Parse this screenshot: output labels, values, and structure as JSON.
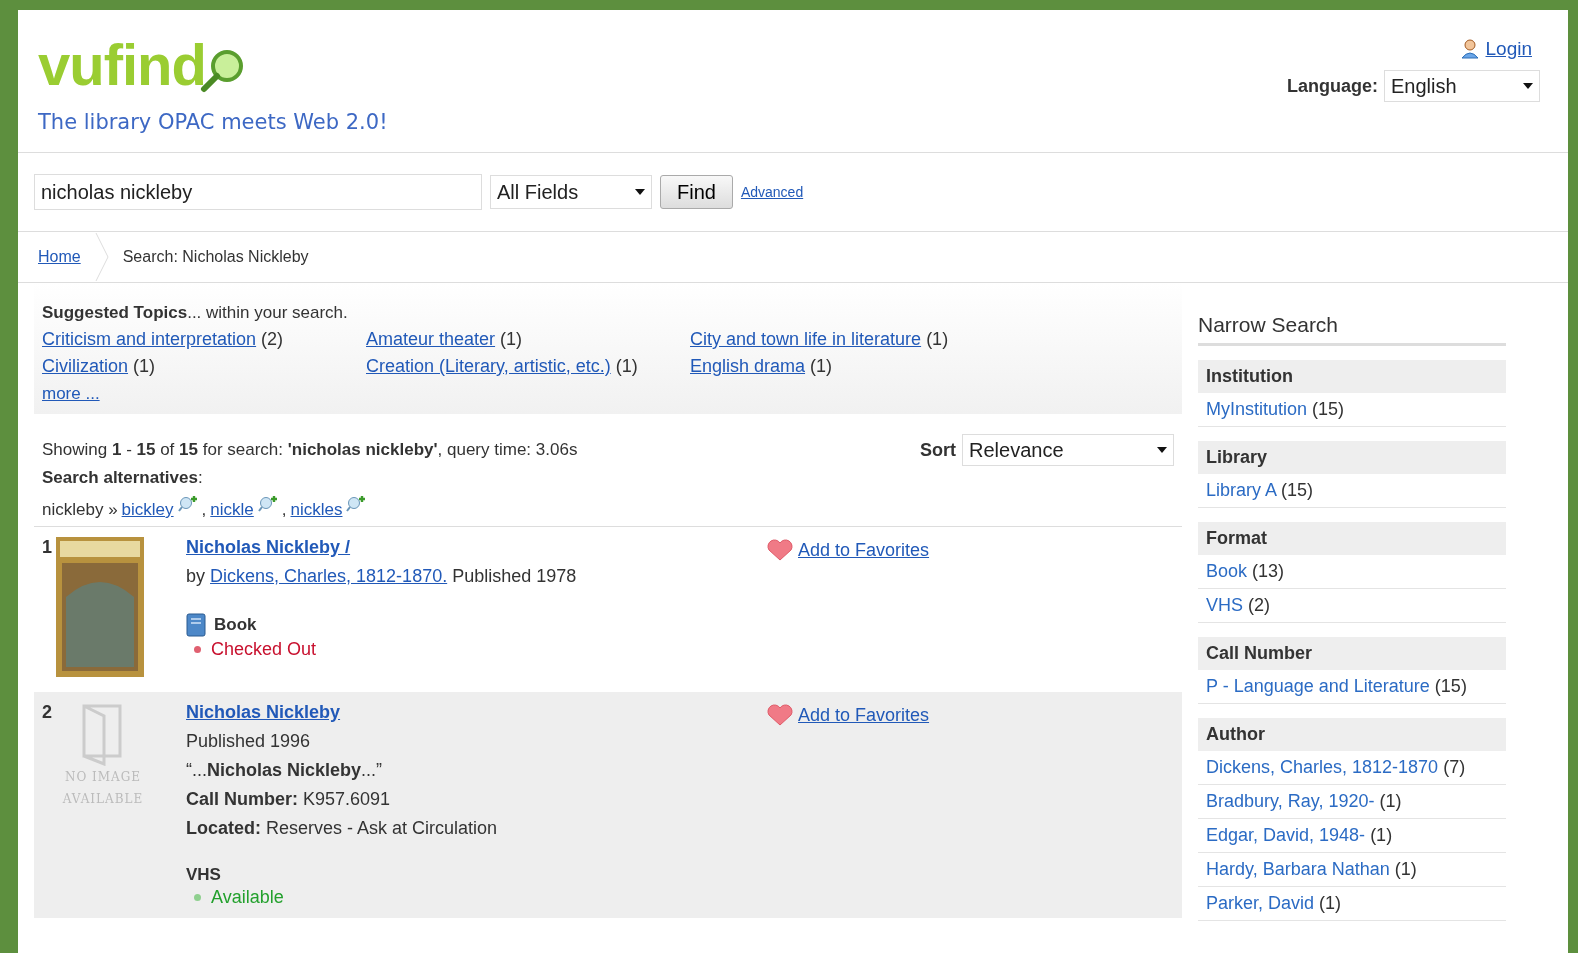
{
  "header": {
    "logo": "vufind",
    "tagline": "The library OPAC meets Web 2.0!",
    "login": "Login",
    "language_label": "Language:",
    "language": "English"
  },
  "search": {
    "value": "nicholas nickleby",
    "field": "All Fields",
    "button": "Find",
    "advanced": "Advanced"
  },
  "breadcrumbs": [
    {
      "label": "Home",
      "link": true
    },
    {
      "label": "Search: Nicholas Nickleby",
      "link": false
    }
  ],
  "topics": {
    "heading": "Suggested Topics",
    "heading_rest": "... within your search.",
    "items": [
      {
        "label": "Criticism and interpretation",
        "count": "(2)"
      },
      {
        "label": "Amateur theater",
        "count": "(1)"
      },
      {
        "label": "City and town life in literature",
        "count": "(1)"
      },
      {
        "label": "Civilization",
        "count": "(1)"
      },
      {
        "label": "Creation (Literary, artistic, etc.)",
        "count": "(1)"
      },
      {
        "label": "English drama",
        "count": "(1)"
      }
    ],
    "more": "more ..."
  },
  "summary": "Showing **1** - **15** of **15** for search: **'nicholas nickleby'**, query time: 3.06s",
  "sort": {
    "label": "Sort",
    "value": "Relevance"
  },
  "alternatives": {
    "heading": "Search alternatives",
    "colon": ":",
    "term": "nickleby »",
    "separator": ",",
    "items": [
      "bickley",
      "nickle",
      "nickles"
    ]
  },
  "results": [
    {
      "number": "1",
      "kind": "cover",
      "title": "Nicholas Nickleby /",
      "by": "by",
      "author": "Dickens, Charles, 1812-1870.",
      "lines": [
        "Published 1978"
      ],
      "format": {
        "label": "Book",
        "kind": "book"
      },
      "status": "Checked Out",
      "available": false,
      "favorite": "Add to Favorites"
    },
    {
      "number": "2",
      "kind": "no_image",
      "no_image": [
        "NO IMAGE",
        "AVAILABLE"
      ],
      "title": "Nicholas Nickleby",
      "lines": [
        "Published 1996",
        "“...**Nicholas Nickleby**...”"
      ],
      "details": [
        {
          "label": "Call Number:",
          "value": "K957.6091"
        },
        {
          "label": "Located:",
          "value": "Reserves - Ask at Circulation"
        }
      ],
      "format": {
        "label": "VHS",
        "kind": "video"
      },
      "status": "Available",
      "available": true,
      "favorite": "Add to Favorites"
    }
  ],
  "narrow": {
    "title": "Narrow Search",
    "groups": [
      {
        "heading": "Institution",
        "items": [
          {
            "label": "MyInstitution",
            "count": "(15)"
          }
        ]
      },
      {
        "heading": "Library",
        "items": [
          {
            "label": "Library A",
            "count": "(15)"
          }
        ]
      },
      {
        "heading": "Format",
        "items": [
          {
            "label": "Book",
            "count": "(13)"
          },
          {
            "label": "VHS",
            "count": "(2)"
          }
        ]
      },
      {
        "heading": "Call Number",
        "items": [
          {
            "label": "P - Language and Literature",
            "count": "(15)"
          }
        ]
      },
      {
        "heading": "Author",
        "items": [
          {
            "label": "Dickens, Charles, 1812-1870",
            "count": "(7)"
          },
          {
            "label": "Bradbury, Ray, 1920-",
            "count": "(1)"
          },
          {
            "label": "Edgar, David, 1948-",
            "count": "(1)"
          },
          {
            "label": "Hardy, Barbara Nathan",
            "count": "(1)"
          },
          {
            "label": "Parker, David",
            "count": "(1)"
          }
        ]
      }
    ]
  }
}
